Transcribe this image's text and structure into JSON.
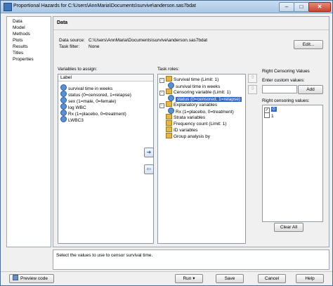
{
  "window": {
    "title": "Proportional Hazards for C:\\Users\\AnnMaria\\Documents\\survive\\anderson.sas7bdat"
  },
  "nav": {
    "items": [
      "Data",
      "Model",
      "Methods",
      "Plots",
      "Results",
      "Titles",
      "Properties"
    ]
  },
  "panel": {
    "heading": "Data",
    "data_source_label": "Data source:",
    "data_source_value": "C:\\Users\\AnnMaria\\Documents\\survive\\anderson.sas7bdat",
    "task_filter_label": "Task filter:",
    "task_filter_value": "None",
    "edit_button": "Edit..."
  },
  "variables": {
    "label": "Variables to assign:",
    "column_header": "Label",
    "items": [
      "survival time in weeks",
      "status (0=censored, 1=relapse)",
      "sex (1=male, 0=female)",
      "log WBC",
      "Rx (1=placebo, 0=treatment)",
      "LWBC3"
    ]
  },
  "task_roles": {
    "label": "Task roles:",
    "role_survival": "Survival time  (Limit: 1)",
    "role_survival_value": "survival time in weeks",
    "role_censoring": "Censoring variable  (Limit: 1)",
    "role_censoring_value": "status (0=censored, 1=relapse)",
    "role_explanatory": "Explanatory variables",
    "role_explanatory_value": "Rx (1=placebo, 0=treatment)",
    "role_strata": "Strata variables",
    "role_frequency": "Frequency count  (Limit: 1)",
    "role_id": "ID variables",
    "role_group": "Group analysis by"
  },
  "censoring": {
    "title": "Right Censoring Values",
    "custom_label": "Enter custom values:",
    "custom_value": "",
    "add_button": "Add",
    "values_label": "Right censoring values:",
    "values": [
      {
        "text": "0",
        "checked": true
      },
      {
        "text": "1",
        "checked": false
      }
    ],
    "clear_button": "Clear All"
  },
  "status": {
    "text": "Select the values to use to censor survival time."
  },
  "footer": {
    "preview": "Preview code",
    "run": "Run",
    "save": "Save",
    "cancel": "Cancel",
    "help": "Help"
  },
  "colors": {
    "selection": "#316ac5",
    "titlebar": "#a9c6e6"
  }
}
